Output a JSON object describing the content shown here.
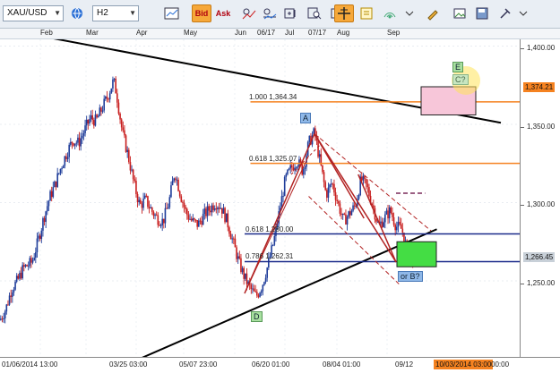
{
  "toolbar": {
    "symbol": "XAU/USD",
    "timeframe": "H2",
    "bid_label": "Bid",
    "ask_label": "Ask"
  },
  "top_time_axis": [
    "Feb",
    "Mar",
    "Apr",
    "May",
    "Jun",
    "06/17",
    "Jul",
    "07/17",
    "Aug",
    "Sep"
  ],
  "price_axis": {
    "labels": [
      "1,400.00",
      "1,350.00",
      "1,300.00",
      "1,250.00"
    ],
    "tag_upper": "1,374.21",
    "tag_current": "1,266.45",
    "tag_upper_color": "#f58220",
    "tag_current_color": "#c8d0d8"
  },
  "bottom_time_axis": {
    "labels": [
      "01/06/2014 13:00",
      "03/25 03:00",
      "05/07 23:00",
      "06/20 01:00",
      "08/04 01:00",
      "09/12"
    ],
    "tag": "10/03/2014 03:00",
    "tag2": "00:00",
    "tag_color": "#f58220"
  },
  "fib_labels": {
    "f1000": "1.000 1,364.34",
    "f618_top": "0.618 1,325.07",
    "f618": "0.618 1,280.00",
    "f786": "0.786 1,262.31"
  },
  "wave_labels": {
    "a": "A",
    "d": "D",
    "e": "E",
    "c": "C?",
    "b": "or B?"
  },
  "colors": {
    "fib_orange": "#f58220",
    "navy": "#1a2a8a",
    "pattern_red": "#b22222",
    "pink_zone": "#f7c6d9",
    "green_zone": "#44dd44",
    "candle_up": "#1f3d9a",
    "candle_down": "#c81e1e"
  },
  "chart_data": {
    "type": "candlestick",
    "symbol": "XAU/USD",
    "timeframe": "H2",
    "x_range": [
      "01/06/2014",
      "10/03/2014"
    ],
    "ylim": [
      1230,
      1410
    ],
    "path": [
      [
        0,
        1225
      ],
      [
        2,
        1232
      ],
      [
        4,
        1245
      ],
      [
        6,
        1250
      ],
      [
        8,
        1258
      ],
      [
        11,
        1262
      ],
      [
        13,
        1275
      ],
      [
        15,
        1290
      ],
      [
        17,
        1303
      ],
      [
        19,
        1312
      ],
      [
        21,
        1323
      ],
      [
        23,
        1332
      ],
      [
        25,
        1340
      ],
      [
        27,
        1338
      ],
      [
        29,
        1346
      ],
      [
        31,
        1354
      ],
      [
        33,
        1352
      ],
      [
        35,
        1360
      ],
      [
        37,
        1368
      ],
      [
        39,
        1378
      ],
      [
        40,
        1370
      ],
      [
        42,
        1345
      ],
      [
        44,
        1330
      ],
      [
        46,
        1312
      ],
      [
        48,
        1298
      ],
      [
        50,
        1302
      ],
      [
        52,
        1295
      ],
      [
        54,
        1290
      ],
      [
        56,
        1288
      ],
      [
        58,
        1300
      ],
      [
        60,
        1320
      ],
      [
        62,
        1305
      ],
      [
        64,
        1293
      ],
      [
        66,
        1288
      ],
      [
        68,
        1286
      ],
      [
        70,
        1292
      ],
      [
        72,
        1296
      ],
      [
        74,
        1300
      ],
      [
        76,
        1297
      ],
      [
        78,
        1288
      ],
      [
        80,
        1275
      ],
      [
        82,
        1262
      ],
      [
        84,
        1252
      ],
      [
        86,
        1245
      ],
      [
        88,
        1240
      ],
      [
        90,
        1247
      ],
      [
        92,
        1260
      ],
      [
        94,
        1275
      ],
      [
        96,
        1295
      ],
      [
        98,
        1315
      ],
      [
        100,
        1322
      ],
      [
        102,
        1327
      ],
      [
        104,
        1320
      ],
      [
        106,
        1338
      ],
      [
        108,
        1345
      ],
      [
        110,
        1325
      ],
      [
        112,
        1305
      ],
      [
        114,
        1313
      ],
      [
        116,
        1300
      ],
      [
        118,
        1288
      ],
      [
        120,
        1293
      ],
      [
        122,
        1298
      ],
      [
        124,
        1315
      ],
      [
        126,
        1310
      ],
      [
        128,
        1298
      ],
      [
        130,
        1285
      ],
      [
        132,
        1290
      ],
      [
        134,
        1295
      ],
      [
        136,
        1285
      ],
      [
        138,
        1283
      ],
      [
        140,
        1268
      ],
      [
        142,
        1262
      ]
    ],
    "trend_lines": [
      {
        "from": [
          -2,
          1412
        ],
        "to": [
          172,
          1351
        ]
      },
      {
        "from": [
          44,
          1197
        ],
        "to": [
          150,
          1283
        ]
      }
    ],
    "fib_levels": [
      1364.34,
      1325.07,
      1280.0,
      1262.31
    ]
  }
}
